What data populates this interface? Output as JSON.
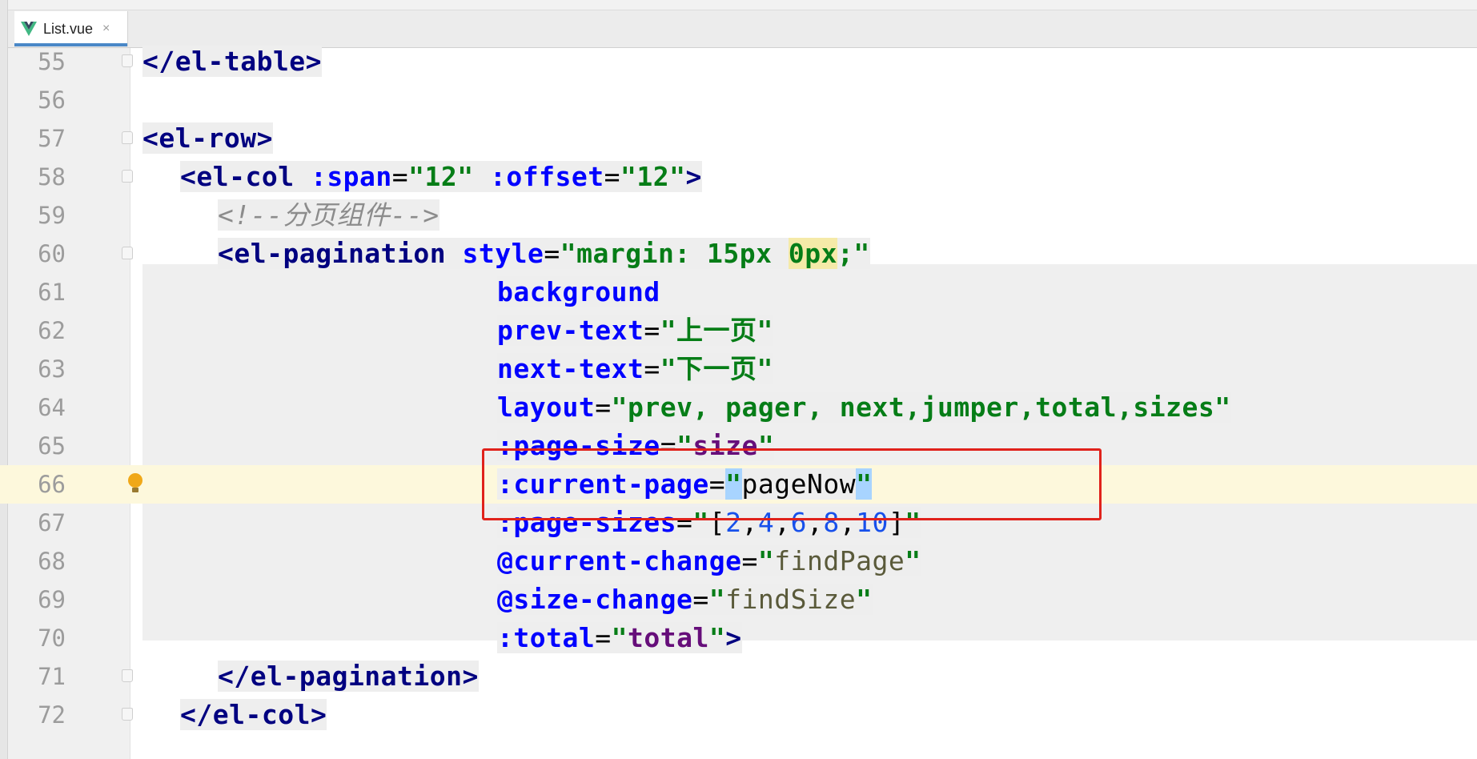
{
  "editor": {
    "tab": {
      "filename": "List.vue",
      "icon": "vue-icon",
      "close_label": "×"
    },
    "breadcrumb": "",
    "current_line": 66,
    "lines": [
      {
        "num": "55",
        "code": "</el-table>"
      },
      {
        "num": "56",
        "code": ""
      },
      {
        "num": "57",
        "code": "<el-row>"
      },
      {
        "num": "58",
        "code": "<el-col :span=\"12\" :offset=\"12\">"
      },
      {
        "num": "59",
        "code": "<!--分页组件-->"
      },
      {
        "num": "60",
        "code": "<el-pagination style=\"margin: 15px 0px;\""
      },
      {
        "num": "61",
        "code": "background"
      },
      {
        "num": "62",
        "code": "prev-text=\"上一页\""
      },
      {
        "num": "63",
        "code": "next-text=\"下一页\""
      },
      {
        "num": "64",
        "code": "layout=\"prev, pager, next,jumper,total,sizes\""
      },
      {
        "num": "65",
        "code": ":page-size=\"size\""
      },
      {
        "num": "66",
        "code": ":current-page=\"pageNow\""
      },
      {
        "num": "67",
        "code": ":page-sizes=\"[2,4,6,8,10]\""
      },
      {
        "num": "68",
        "code": "@current-change=\"findPage\""
      },
      {
        "num": "69",
        "code": "@size-change=\"findSize\""
      },
      {
        "num": "70",
        "code": ":total=\"total\">"
      },
      {
        "num": "71",
        "code": "</el-pagination>"
      },
      {
        "num": "72",
        "code": "</el-col>"
      }
    ],
    "tokens": {
      "l55": [
        "</el-table>"
      ],
      "l57": [
        "<el-row>"
      ],
      "l58": [
        "<el-col",
        " :span",
        "=",
        "\"12\"",
        " :offset",
        "=",
        "\"12\"",
        ">"
      ],
      "l59": [
        "<!--分页组件-->"
      ],
      "l60": [
        "<el-pagination",
        " style",
        "=",
        "\"margin: 15px ",
        "0px",
        ";\""
      ],
      "l61": [
        "background"
      ],
      "l62": [
        "prev-text",
        "=",
        "\"上一页\""
      ],
      "l63": [
        "next-text",
        "=",
        "\"下一页\""
      ],
      "l64": [
        "layout",
        "=",
        "\"prev, pager, next,jumper,total,sizes\""
      ],
      "l65": [
        ":page-size",
        "=",
        "\"",
        "size",
        "\""
      ],
      "l66": [
        ":current-page",
        "=",
        "\"",
        "pageNow",
        "\""
      ],
      "l67": [
        ":page-sizes",
        "=",
        "\"",
        "[",
        "2",
        ",",
        "4",
        ",",
        "6",
        ",",
        "8",
        ",",
        "10",
        "]",
        "\""
      ],
      "l68": [
        "@current-change",
        "=",
        "\"",
        "findPage",
        "\""
      ],
      "l69": [
        "@size-change",
        "=",
        "\"",
        "findSize",
        "\""
      ],
      "l70": [
        ":total",
        "=",
        "\"",
        "total",
        "\"",
        ">"
      ],
      "l71": [
        "</el-pagination>"
      ],
      "l72": [
        "</el-col>"
      ]
    },
    "colors": {
      "tag": "#000080",
      "attribute": "#0000ff",
      "string": "#067d17",
      "variable": "#660e7a",
      "number": "#1750eb",
      "comment": "#8c8c8c",
      "current_line_bg": "#fdf8dc",
      "annotation_box": "#e0221b",
      "tab_underline": "#4a88c7"
    }
  }
}
